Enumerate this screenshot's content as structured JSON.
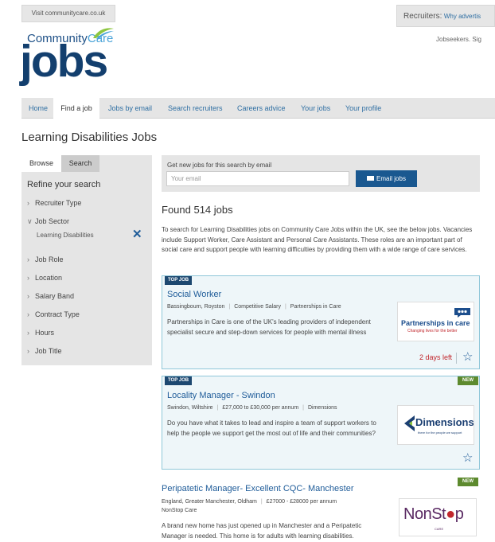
{
  "top": {
    "visit_link": "Visit communitycare.co.uk",
    "recruiters_label": "Recruiters:",
    "recruiters_link": "Why advertis",
    "jobseekers_link": "Jobseekers. Sig"
  },
  "logo": {
    "community": "Community",
    "care": "Care",
    "jobs": "jobs"
  },
  "nav": [
    {
      "label": "Home"
    },
    {
      "label": "Find a job"
    },
    {
      "label": "Jobs by email"
    },
    {
      "label": "Search recruiters"
    },
    {
      "label": "Careers advice"
    },
    {
      "label": "Your jobs"
    },
    {
      "label": "Your profile"
    }
  ],
  "page_title": "Learning Disabilities Jobs",
  "sidebar": {
    "tabs": [
      {
        "label": "Browse"
      },
      {
        "label": "Search"
      }
    ],
    "refine_title": "Refine your search",
    "facets": [
      {
        "label": "Recruiter Type"
      },
      {
        "label": "Job Sector"
      },
      {
        "label": "Job Role"
      },
      {
        "label": "Location"
      },
      {
        "label": "Salary Band"
      },
      {
        "label": "Contract Type"
      },
      {
        "label": "Hours"
      },
      {
        "label": "Job Title"
      }
    ],
    "selected_sector": "Learning Disabilities"
  },
  "email_alert": {
    "label": "Get new jobs for this search by email",
    "placeholder": "Your email",
    "button": "Email jobs"
  },
  "results": {
    "found": "Found 514 jobs",
    "intro": "To search for Learning Disabilities jobs on Community Care Jobs within the UK, see the below jobs. Vacancies include Support Worker, Care Assistant and Personal Care Assistants. These roles are an important part of social care and support people with learning difficulties by providing them with a wide range of care services."
  },
  "jobs": [
    {
      "badge": "TOP JOB",
      "title": "Social Worker",
      "location": "Bassingbourn, Royston",
      "salary": "Competitive Salary",
      "company": "Partnerships in Care",
      "description": "Partnerships in Care is one of the UK's leading providers of independent specialist secure and step-down services for people with mental illness",
      "logo_text": "Partnerships in care",
      "logo_tagline": "Changing lives for the better",
      "days_left": "2 days left"
    },
    {
      "badge": "TOP JOB",
      "new": "NEW",
      "title": "Locality Manager - Swindon",
      "location": "Swindon, Wiltshire",
      "salary": "£27,000 to £30,000 per annum",
      "company": "Dimensions",
      "description": "Do you have what it takes to lead and inspire a team of support workers to help the people we support get the most out of life and their communities?",
      "logo_text": "Dimensions",
      "logo_tagline": "there for the people we support"
    },
    {
      "new": "NEW",
      "title": "Peripatetic Manager- Excellent CQC- Manchester",
      "location": "England, Greater Manchester, Oldham",
      "salary": "£27000 - £28000 per annum",
      "company": "NonStop Care",
      "description": "A brand new home has just opened up in Manchester and a Peripatetic Manager is needed. This home is for adults with learning disabilities.",
      "logo_text_a": "NonSt",
      "logo_text_b": "p",
      "logo_tagline": "CARE"
    }
  ],
  "colors": {
    "link": "#1f5c99",
    "navy": "#133f6e",
    "new_badge": "#5d8a2e",
    "days_left": "#c1272d",
    "card_border": "#8fc7d9",
    "nonstop_purple": "#5a2a63"
  }
}
